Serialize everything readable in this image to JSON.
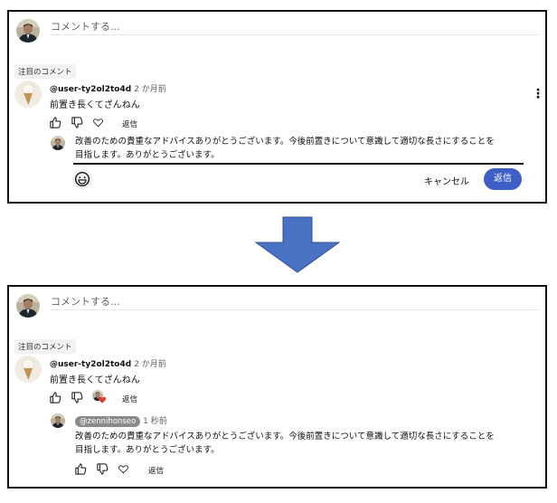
{
  "before": {
    "comment_box": {
      "placeholder": "コメントする..."
    },
    "featured_label": "注目のコメント",
    "comment": {
      "author": "@user-ty2ol2to4d",
      "time": "2 か月前",
      "text": "前置き長くてざんねん",
      "reply_label": "返信"
    },
    "reply_draft": {
      "text_line1": "改善のための貴重なアドバイスありがとうございます。今後前置きについて意識して適切な長さにすることを",
      "text_line2": "目指します。ありがとうございます。",
      "cancel_label": "キャンセル",
      "submit_label": "返信"
    }
  },
  "after": {
    "comment_box": {
      "placeholder": "コメントする..."
    },
    "featured_label": "注目のコメント",
    "comment": {
      "author": "@user-ty2ol2to4d",
      "time": "2 か月前",
      "text": "前置き長くてざんねん",
      "reply_label": "返信"
    },
    "reply": {
      "author": "@zennihonseo",
      "time": "1 秒前",
      "text_line1": "改善のための貴重なアドバイスありがとうございます。今後前置きについて意識して適切な長さにすることを",
      "text_line2": "目指します。ありがとうございます。",
      "reply_label": "返信"
    }
  },
  "colors": {
    "accent": "#3d5fc6",
    "arrow": "#4a72c4",
    "heart": "#e53935"
  },
  "icons": [
    "avatar",
    "ice-cream-avatar",
    "thumb-up-icon",
    "thumb-down-icon",
    "heart-icon",
    "kebab-menu-icon",
    "emoji-icon",
    "arrow-down-icon"
  ]
}
